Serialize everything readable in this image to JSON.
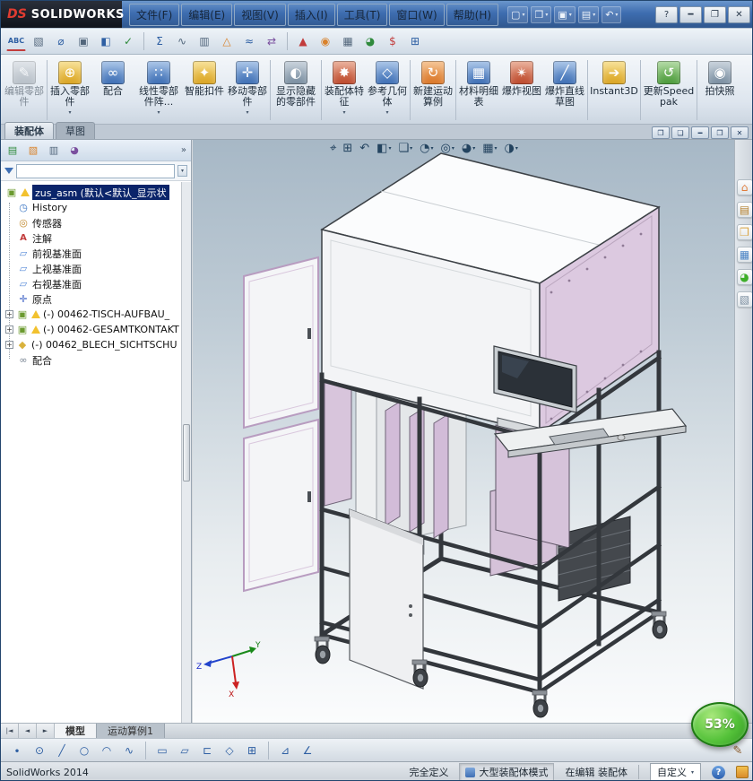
{
  "colors": {
    "titlebar_blue": "#3e6db0",
    "selection_blue": "#0a246a",
    "toolbar_bg": "#dce4ee",
    "viewport_top": "#a7b8c6",
    "model_pink": "#d8c5dc",
    "frame_dark": "#33373c",
    "badge_green": "#46b42e",
    "warning_yellow": "#f2c12e"
  },
  "ui": {
    "caret": "▾",
    "chevrons": "»",
    "plus": "+",
    "tab_scroll_first": "|◄",
    "tab_scroll_prev": "◄",
    "tab_scroll_next": "►"
  },
  "titlebar": {
    "logo_mark": "DS",
    "logo_text": "SOLIDWORKS",
    "menus": [
      "文件(F)",
      "编辑(E)",
      "视图(V)",
      "插入(I)",
      "工具(T)",
      "窗口(W)",
      "帮助(H)"
    ],
    "quick_access": [
      {
        "name": "new-document-icon",
        "glyph": "▢"
      },
      {
        "name": "open-document-icon",
        "glyph": "❒"
      },
      {
        "name": "save-icon",
        "glyph": "▣"
      },
      {
        "name": "print-icon",
        "glyph": "▤"
      },
      {
        "name": "undo-icon",
        "glyph": "↶"
      }
    ],
    "window_buttons": [
      {
        "name": "help-button",
        "glyph": "?"
      },
      {
        "name": "minimize-button",
        "glyph": "━"
      },
      {
        "name": "maximize-button",
        "glyph": "❐"
      },
      {
        "name": "close-button",
        "glyph": "✕"
      }
    ]
  },
  "toolbar2": {
    "icons": [
      {
        "name": "spell-check-icon",
        "glyph": "ABC"
      },
      {
        "name": "format-painter-icon",
        "glyph": "▧"
      },
      {
        "name": "measure-icon",
        "glyph": "⌀"
      },
      {
        "name": "mass-properties-icon",
        "glyph": "▣"
      },
      {
        "name": "section-properties-icon",
        "glyph": "◧"
      },
      {
        "name": "check-icon",
        "glyph": "✓"
      },
      {
        "name": "equations-icon",
        "glyph": "Σ"
      },
      {
        "name": "curvature-icon",
        "glyph": "∿"
      },
      {
        "name": "zebra-stripes-icon",
        "glyph": "▥"
      },
      {
        "name": "draft-analysis-icon",
        "glyph": "△"
      },
      {
        "name": "deviation-analysis-icon",
        "glyph": "≈"
      },
      {
        "name": "symmetry-check-icon",
        "glyph": "⇄"
      },
      {
        "name": "simulation-icon",
        "glyph": "▲"
      },
      {
        "name": "motion-icon",
        "glyph": "◉"
      },
      {
        "name": "toolbox-icon",
        "glyph": "▦"
      },
      {
        "name": "photoview-icon",
        "glyph": "◕"
      },
      {
        "name": "costing-icon",
        "glyph": "$"
      },
      {
        "name": "options-icon",
        "glyph": "⊞"
      }
    ]
  },
  "command_manager": {
    "tabs": [
      {
        "label": "装配体"
      },
      {
        "label": "草图"
      }
    ],
    "buttons": [
      {
        "name": "edit-component",
        "label": "编辑零部件",
        "glyph": "✎"
      },
      {
        "name": "insert-components",
        "label": "插入零部件",
        "glyph": "⊕"
      },
      {
        "name": "mate",
        "label": "配合",
        "glyph": "∞"
      },
      {
        "name": "linear-component-pattern",
        "label": "线性零部件阵...",
        "glyph": "∷"
      },
      {
        "name": "smart-fasteners",
        "label": "智能扣件",
        "glyph": "✦"
      },
      {
        "name": "move-component",
        "label": "移动零部件",
        "glyph": "✛"
      },
      {
        "name": "show-hidden-components",
        "label": "显示隐藏的零部件",
        "glyph": "◐"
      },
      {
        "name": "assembly-features",
        "label": "装配体特征",
        "glyph": "✸"
      },
      {
        "name": "reference-geometry",
        "label": "参考几何体",
        "glyph": "◇"
      },
      {
        "name": "new-motion-study",
        "label": "新建运动算例",
        "glyph": "↻"
      },
      {
        "name": "bill-of-materials",
        "label": "材料明细表",
        "glyph": "▦"
      },
      {
        "name": "exploded-view",
        "label": "爆炸视图",
        "glyph": "✴"
      },
      {
        "name": "explode-line-sketch",
        "label": "爆炸直线草图",
        "glyph": "╱"
      },
      {
        "name": "instant3d",
        "label": "Instant3D",
        "glyph": "➔"
      },
      {
        "name": "update-speedpak",
        "label": "更新Speedpak",
        "glyph": "↺"
      },
      {
        "name": "take-snapshot",
        "label": "拍快照",
        "glyph": "◉"
      }
    ]
  },
  "headsup": {
    "icons": [
      {
        "name": "zoom-fit-icon",
        "glyph": "⌖"
      },
      {
        "name": "zoom-area-icon",
        "glyph": "⊞"
      },
      {
        "name": "previous-view-icon",
        "glyph": "↶"
      },
      {
        "name": "section-view-icon",
        "glyph": "◧"
      },
      {
        "name": "view-orientation-icon",
        "glyph": "❏"
      },
      {
        "name": "display-style-icon",
        "glyph": "◔"
      },
      {
        "name": "hide-show-items-icon",
        "glyph": "◎"
      },
      {
        "name": "edit-appearance-icon",
        "glyph": "◕"
      },
      {
        "name": "apply-scene-icon",
        "glyph": "▦"
      },
      {
        "name": "view-settings-icon",
        "glyph": "◑"
      }
    ]
  },
  "mdi_buttons": [
    {
      "name": "window-new-icon",
      "glyph": "❐"
    },
    {
      "name": "window-cascade-icon",
      "glyph": "❏"
    },
    {
      "name": "window-minimize-icon",
      "glyph": "━"
    },
    {
      "name": "window-restore-icon",
      "glyph": "❐"
    },
    {
      "name": "window-close-icon",
      "glyph": "✕"
    }
  ],
  "fm_toolbar": {
    "icons": [
      {
        "name": "featuremanager-tab-icon",
        "glyph": "▤"
      },
      {
        "name": "propertymanager-tab-icon",
        "glyph": "▧"
      },
      {
        "name": "configurationmanager-tab-icon",
        "glyph": "▥"
      },
      {
        "name": "displaymanager-tab-icon",
        "glyph": "◕"
      }
    ]
  },
  "feature_tree": {
    "root_glyph": "▣",
    "root_label": "zus_asm (默认<默认_显示状",
    "items": [
      {
        "label": "History",
        "glyph": "◷"
      },
      {
        "label": "传感器",
        "glyph": "◎"
      },
      {
        "label": "注解",
        "glyph": "A"
      },
      {
        "label": "前视基准面",
        "glyph": "▱"
      },
      {
        "label": "上视基准面",
        "glyph": "▱"
      },
      {
        "label": "右视基准面",
        "glyph": "▱"
      },
      {
        "label": "原点",
        "glyph": "✛"
      },
      {
        "label": "(-) 00462-TISCH-AUFBAU_",
        "glyph": "▣"
      },
      {
        "label": "(-) 00462-GESAMTKONTAKT",
        "glyph": "▣"
      },
      {
        "label": "(-) 00462_BLECH_SICHTSCHU",
        "glyph": "◆"
      },
      {
        "label": "配合",
        "glyph": "∞"
      }
    ]
  },
  "task_pane": {
    "icons": [
      {
        "name": "resources-home-icon",
        "glyph": "⌂"
      },
      {
        "name": "design-library-icon",
        "glyph": "▤"
      },
      {
        "name": "file-explorer-icon",
        "glyph": "❒"
      },
      {
        "name": "view-palette-icon",
        "glyph": "▦"
      },
      {
        "name": "appearances-icon",
        "glyph": "◕"
      },
      {
        "name": "custom-properties-icon",
        "glyph": "▧"
      }
    ]
  },
  "bottom_tabs": {
    "tabs": [
      {
        "label": "模型"
      },
      {
        "label": "运动算例1"
      }
    ]
  },
  "sketchbar": {
    "icons": [
      {
        "name": "point-icon",
        "glyph": "∙"
      },
      {
        "name": "centerpoint-circle-icon",
        "glyph": "⊙"
      },
      {
        "name": "line-icon",
        "glyph": "╱"
      },
      {
        "name": "circle-icon",
        "glyph": "○"
      },
      {
        "name": "arc-icon",
        "glyph": "◠"
      },
      {
        "name": "spline-icon",
        "glyph": "∿"
      },
      {
        "name": "rectangle-icon",
        "glyph": "▭"
      },
      {
        "name": "parallelogram-icon",
        "glyph": "▱"
      },
      {
        "name": "slot-icon",
        "glyph": "⊏"
      },
      {
        "name": "polygon-icon",
        "glyph": "◇"
      },
      {
        "name": "pattern-icon",
        "glyph": "⊞"
      },
      {
        "name": "chamfer-icon",
        "glyph": "⊿"
      },
      {
        "name": "dimension-icon",
        "glyph": "∠"
      }
    ],
    "pencil_glyph": "✎"
  },
  "statusbar": {
    "app_version": "SolidWorks 2014",
    "fully_defined": "完全定义",
    "large_assembly_mode": "大型装配体模式",
    "editing_label": "在编辑 装配体",
    "custom_label": "自定义",
    "help_glyph": "?"
  },
  "viewport": {
    "progress_badge": "53%",
    "triad": {
      "x": "X",
      "y": "Y",
      "z": "Z"
    }
  }
}
